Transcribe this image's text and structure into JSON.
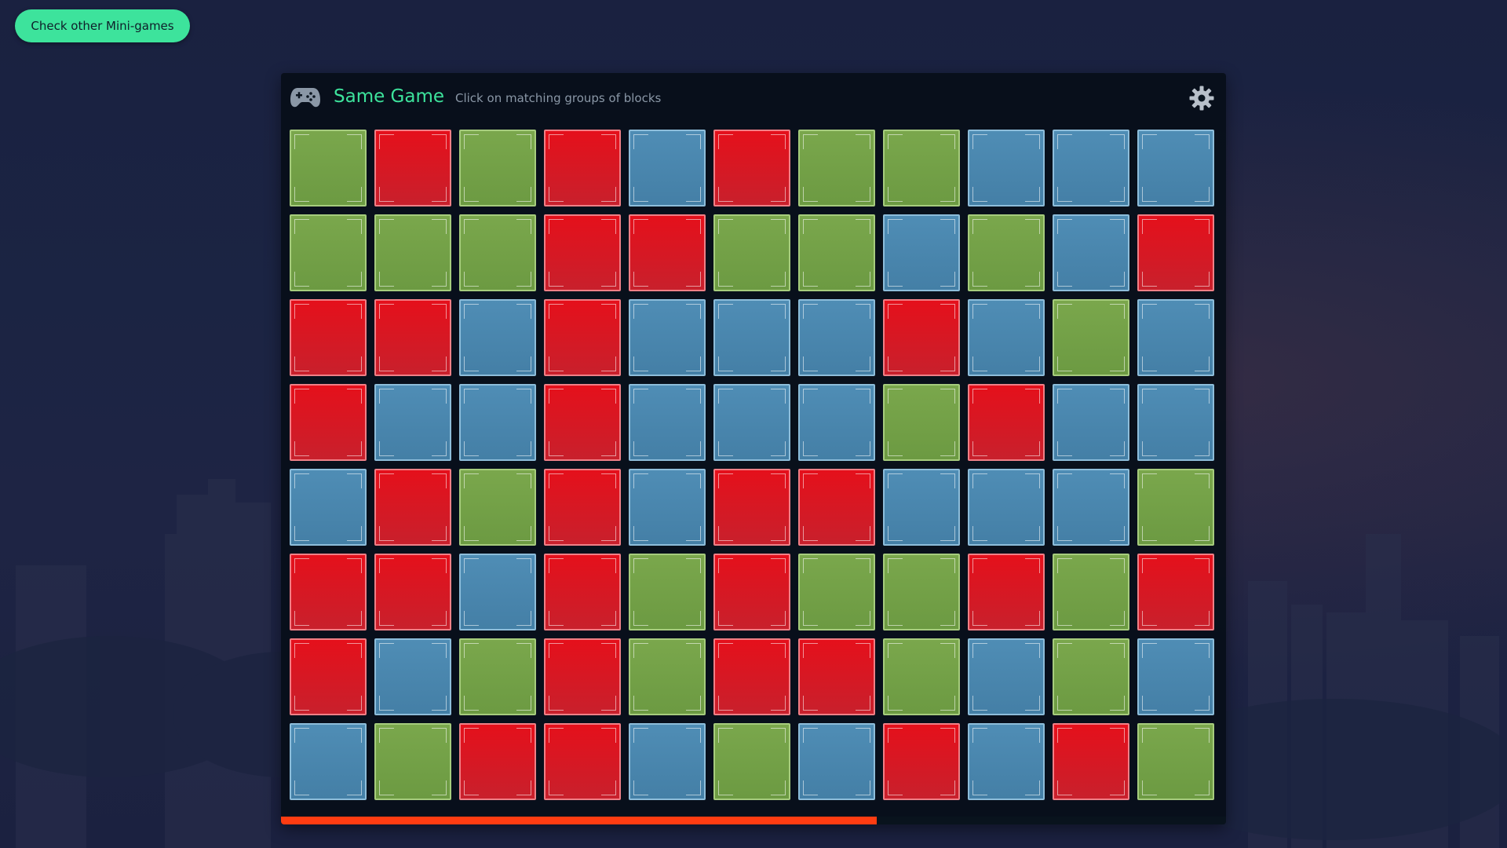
{
  "app": {
    "back_button_label": "Check other Mini-games"
  },
  "game": {
    "title": "Same Game",
    "subtitle": "Click on matching groups of blocks",
    "settings_icon": "gear-icon",
    "header_icon": "gamepad-icon"
  },
  "colors": {
    "red": "#e5101b",
    "green": "#7aa74c",
    "blue": "#4f8db5",
    "accent": "#3de39c",
    "progress": "#ff3c12"
  },
  "board": {
    "columns": 11,
    "rows": [
      [
        "green",
        "red",
        "green",
        "red",
        "blue",
        "red",
        "green",
        "green",
        "blue",
        "blue",
        "blue"
      ],
      [
        "green",
        "green",
        "green",
        "red",
        "red",
        "green",
        "green",
        "blue",
        "green",
        "blue",
        "red"
      ],
      [
        "red",
        "red",
        "blue",
        "red",
        "blue",
        "blue",
        "blue",
        "red",
        "blue",
        "green",
        "blue"
      ],
      [
        "red",
        "blue",
        "blue",
        "red",
        "blue",
        "blue",
        "blue",
        "green",
        "red",
        "blue",
        "blue"
      ],
      [
        "blue",
        "red",
        "green",
        "red",
        "blue",
        "red",
        "red",
        "blue",
        "blue",
        "blue",
        "green"
      ],
      [
        "red",
        "red",
        "blue",
        "red",
        "green",
        "red",
        "green",
        "green",
        "red",
        "green",
        "red"
      ],
      [
        "red",
        "blue",
        "green",
        "red",
        "green",
        "red",
        "red",
        "green",
        "blue",
        "green",
        "blue"
      ],
      [
        "blue",
        "green",
        "red",
        "red",
        "blue",
        "green",
        "blue",
        "red",
        "blue",
        "red",
        "green"
      ]
    ]
  },
  "progress": {
    "fraction": 0.63
  }
}
